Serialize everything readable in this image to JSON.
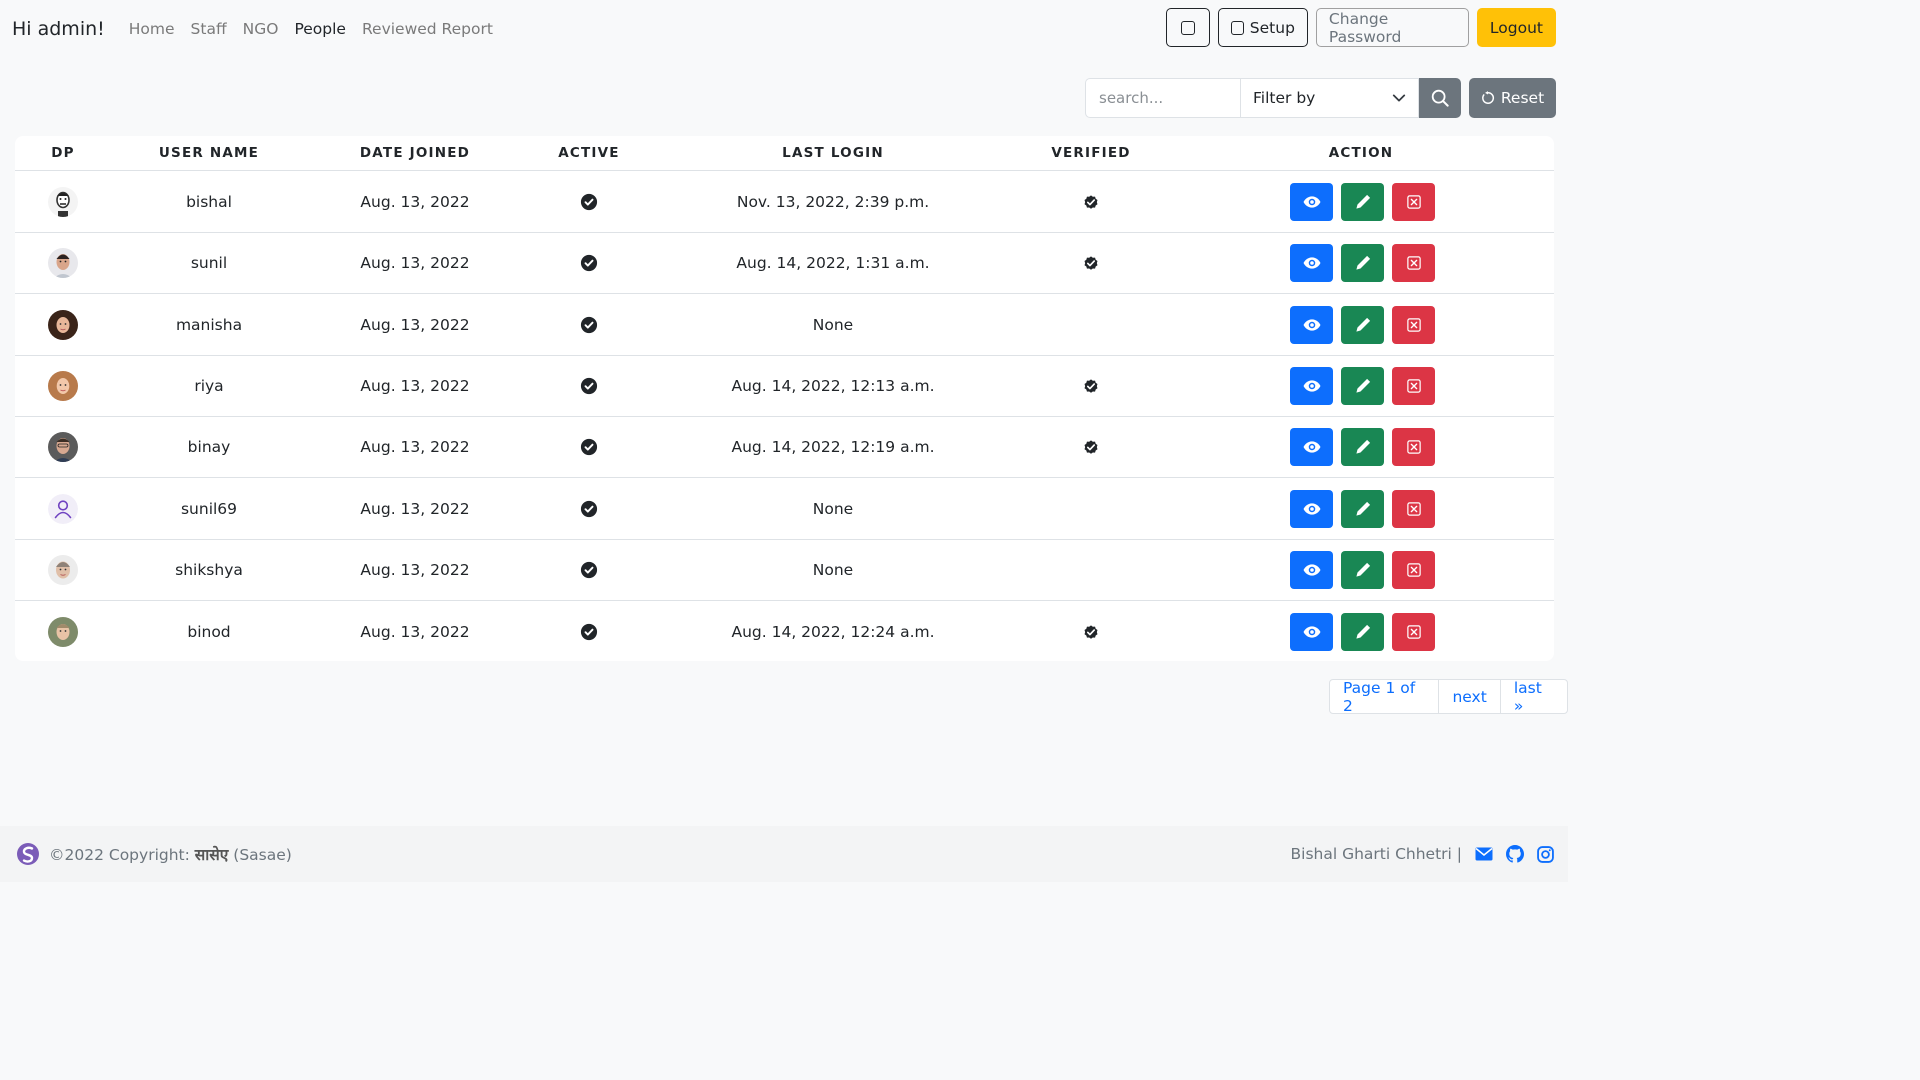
{
  "nav": {
    "brand": "Hi admin!",
    "links": [
      "Home",
      "Staff",
      "NGO",
      "People",
      "Reviewed Report"
    ],
    "active": "People",
    "setup_label": "Setup",
    "change_password_label": "Change Password",
    "logout_label": "Logout"
  },
  "toolbar": {
    "search_placeholder": "search...",
    "filter_label": "Filter by",
    "reset_label": "Reset"
  },
  "table": {
    "headers": [
      "DP",
      "USER NAME",
      "DATE JOINED",
      "ACTIVE",
      "LAST LOGIN",
      "VERIFIED",
      "ACTION"
    ],
    "rows": [
      {
        "username": "bishal",
        "date_joined": "Aug. 13, 2022",
        "active": true,
        "last_login": "Nov. 13, 2022, 2:39 p.m.",
        "verified": true
      },
      {
        "username": "sunil",
        "date_joined": "Aug. 13, 2022",
        "active": true,
        "last_login": "Aug. 14, 2022, 1:31 a.m.",
        "verified": true
      },
      {
        "username": "manisha",
        "date_joined": "Aug. 13, 2022",
        "active": true,
        "last_login": "None",
        "verified": false
      },
      {
        "username": "riya",
        "date_joined": "Aug. 13, 2022",
        "active": true,
        "last_login": "Aug. 14, 2022, 12:13 a.m.",
        "verified": true
      },
      {
        "username": "binay",
        "date_joined": "Aug. 13, 2022",
        "active": true,
        "last_login": "Aug. 14, 2022, 12:19 a.m.",
        "verified": true
      },
      {
        "username": "sunil69",
        "date_joined": "Aug. 13, 2022",
        "active": true,
        "last_login": "None",
        "verified": false
      },
      {
        "username": "shikshya",
        "date_joined": "Aug. 13, 2022",
        "active": true,
        "last_login": "None",
        "verified": false
      },
      {
        "username": "binod",
        "date_joined": "Aug. 13, 2022",
        "active": true,
        "last_login": "Aug. 14, 2022, 12:24 a.m.",
        "verified": true
      }
    ]
  },
  "pagination": {
    "page_label": "Page 1 of 2",
    "next_label": "next",
    "last_label": "last »"
  },
  "footer": {
    "copyright": "©2022 Copyright:",
    "brand_devanagari": "सासेए",
    "brand_latin": "(Sasae)",
    "author": "Bishal Gharti Chhetri |"
  },
  "colors": {
    "view": "#0d6efd",
    "edit": "#198754",
    "delete": "#dc3545",
    "logout": "#ffc107",
    "secondary": "#6c757d"
  }
}
